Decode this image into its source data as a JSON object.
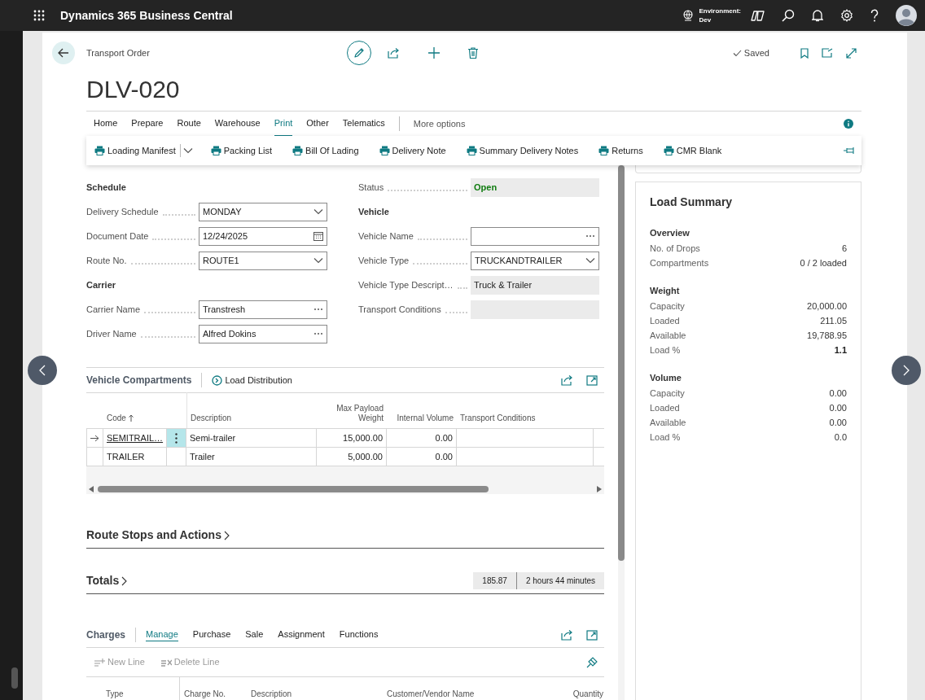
{
  "app_bar": {
    "title": "Dynamics 365 Business Central",
    "environment_label": "Environment:",
    "environment_name": "Dev"
  },
  "page": {
    "caption": "Transport Order",
    "title": "DLV-020",
    "save_state": "Saved"
  },
  "ribbon": {
    "tabs": [
      {
        "label": "Home",
        "selected": false
      },
      {
        "label": "Prepare",
        "selected": false
      },
      {
        "label": "Route",
        "selected": false
      },
      {
        "label": "Warehouse",
        "selected": false
      },
      {
        "label": "Print",
        "selected": true
      },
      {
        "label": "Other",
        "selected": false
      },
      {
        "label": "Telematics",
        "selected": false
      }
    ],
    "more": "More options",
    "actions": [
      {
        "label": "Loading Manifest",
        "has_menu": true
      },
      {
        "label": "Packing List",
        "has_menu": false
      },
      {
        "label": "Bill Of Lading",
        "has_menu": false
      },
      {
        "label": "Delivery Note",
        "has_menu": false
      },
      {
        "label": "Summary Delivery Notes",
        "has_menu": false
      },
      {
        "label": "Returns",
        "has_menu": false
      },
      {
        "label": "CMR Blank",
        "has_menu": false
      }
    ]
  },
  "general": {
    "columns": [
      [
        {
          "kind": "heading",
          "label": "Schedule"
        },
        {
          "kind": "select",
          "label": "Delivery Schedule",
          "value": "MONDAY"
        },
        {
          "kind": "date",
          "label": "Document Date",
          "value": "12/24/2025"
        },
        {
          "kind": "select",
          "label": "Route No.",
          "value": "ROUTE1"
        },
        {
          "kind": "heading",
          "label": "Carrier"
        },
        {
          "kind": "lookup",
          "label": "Carrier Name",
          "value": "Transtresh"
        },
        {
          "kind": "lookup",
          "label": "Driver Name",
          "value": "Alfred Dokins"
        }
      ],
      [
        {
          "kind": "status",
          "label": "Status",
          "value": "Open"
        },
        {
          "kind": "heading",
          "label": "Vehicle"
        },
        {
          "kind": "lookup",
          "label": "Vehicle Name"
        },
        {
          "kind": "select",
          "label": "Vehicle Type",
          "value": "TRUCKANDTRAILER"
        },
        {
          "kind": "readonly",
          "label": "Vehicle Type Descript…",
          "value": "Truck & Trailer"
        },
        {
          "kind": "readonly",
          "label": "Transport Conditions"
        }
      ]
    ]
  },
  "compartments": {
    "title": "Vehicle Compartments",
    "action": "Load Distribution",
    "columns": [
      {
        "label": "Code",
        "kind": "text",
        "sorted": true
      },
      {
        "label": "Description",
        "kind": "text",
        "sorted": false
      },
      {
        "label": "Max Payload Weight",
        "kind": "number",
        "sorted": false
      },
      {
        "label": "Internal Volume",
        "kind": "number",
        "sorted": false
      },
      {
        "label": "Transport Conditions",
        "kind": "text",
        "sorted": false
      }
    ],
    "rows": [
      {
        "selected": true,
        "cells": [
          "SEMITRAIL…",
          "Semi-trailer",
          "15,000.00",
          "0.00"
        ]
      },
      {
        "selected": false,
        "cells": [
          "TRAILER",
          "Trailer",
          "5,000.00",
          "0.00"
        ]
      }
    ]
  },
  "route_stops": {
    "title": "Route Stops and Actions"
  },
  "totals": {
    "title": "Totals",
    "values": [
      "185.87",
      "2 hours 44 minutes"
    ]
  },
  "charges": {
    "title": "Charges",
    "tabs": [
      {
        "label": "Manage",
        "selected": true
      },
      {
        "label": "Purchase",
        "selected": false
      },
      {
        "label": "Sale",
        "selected": false
      },
      {
        "label": "Assignment",
        "selected": false
      },
      {
        "label": "Functions",
        "selected": false
      }
    ],
    "actions": [
      {
        "label": "New Line",
        "disabled": true
      },
      {
        "label": "Delete Line",
        "disabled": true
      }
    ],
    "columns": [
      "Type",
      "Charge No.",
      "Description",
      "Customer/Vendor Name",
      "Quantity"
    ]
  },
  "load_summary": {
    "title": "Load Summary",
    "groups": [
      {
        "title": "Overview",
        "rows": [
          {
            "label": "No. of Drops",
            "value": "6",
            "emphasis": false
          },
          {
            "label": "Compartments",
            "value": "0 / 2 loaded",
            "emphasis": false
          }
        ]
      },
      {
        "title": "Weight",
        "rows": [
          {
            "label": "Capacity",
            "value": "20,000.00",
            "emphasis": false
          },
          {
            "label": "Loaded",
            "value": "211.05",
            "emphasis": false
          },
          {
            "label": "Available",
            "value": "19,788.95",
            "emphasis": false
          },
          {
            "label": "Load %",
            "value": "1.1",
            "emphasis": true
          }
        ]
      },
      {
        "title": "Volume",
        "rows": [
          {
            "label": "Capacity",
            "value": "0.00",
            "emphasis": false
          },
          {
            "label": "Loaded",
            "value": "0.00",
            "emphasis": false
          },
          {
            "label": "Available",
            "value": "0.00",
            "emphasis": false
          },
          {
            "label": "Load %",
            "value": "0.0",
            "emphasis": false
          }
        ]
      }
    ]
  }
}
